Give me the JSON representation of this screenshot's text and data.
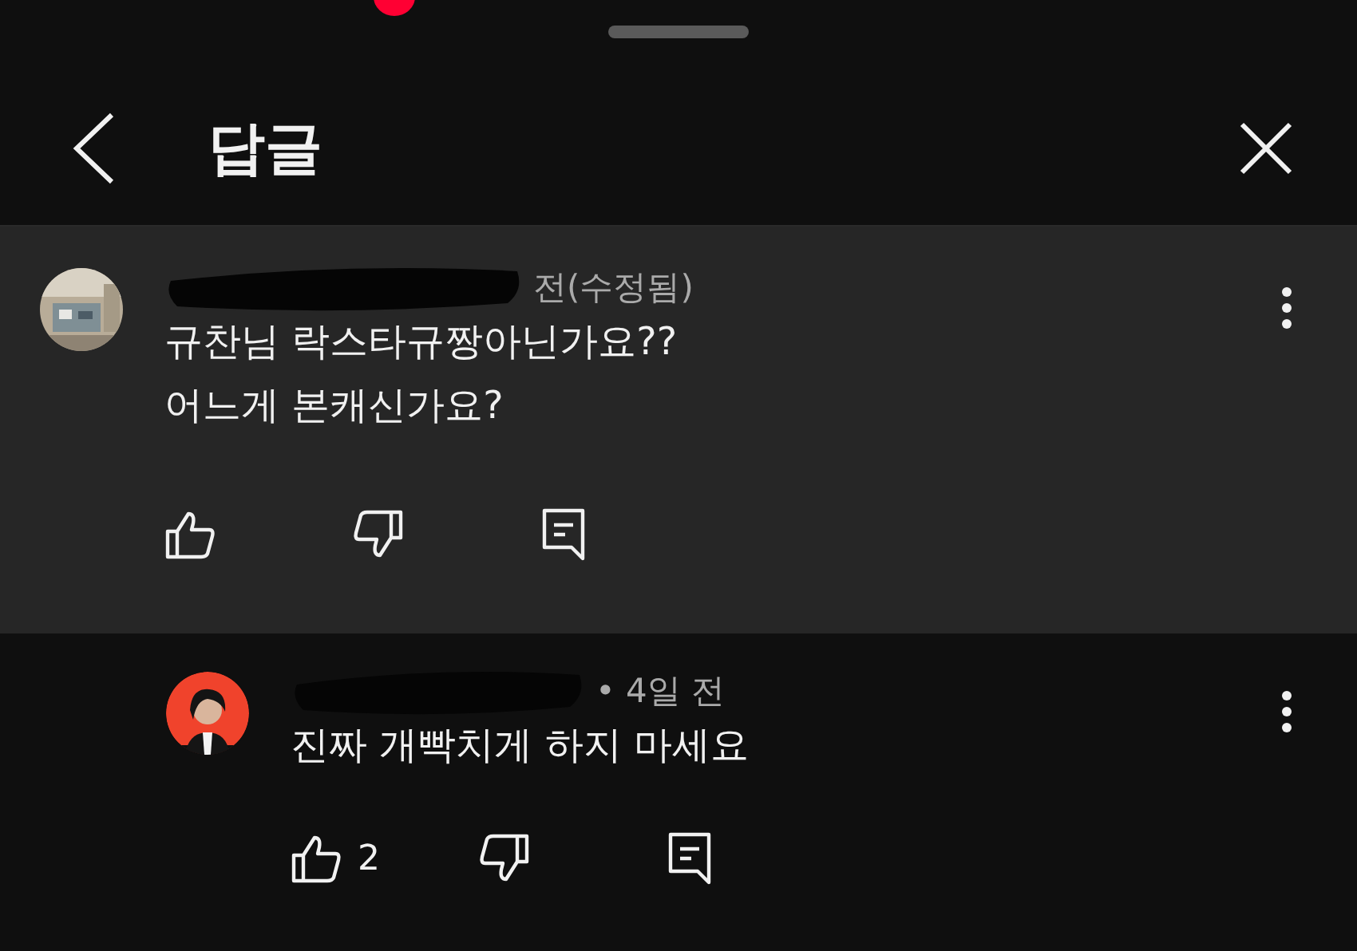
{
  "header": {
    "title": "답글"
  },
  "comments": [
    {
      "kind": "parent",
      "highlighted": true,
      "meta": "전(수정됨)",
      "lines": [
        "규찬님 락스타규짱아닌가요??",
        "어느게 본캐신가요?"
      ]
    },
    {
      "kind": "reply",
      "highlighted": false,
      "meta": "• 4일 전",
      "lines": [
        "진짜 개빡치게 하지 마세요"
      ],
      "like_count": "2"
    }
  ]
}
